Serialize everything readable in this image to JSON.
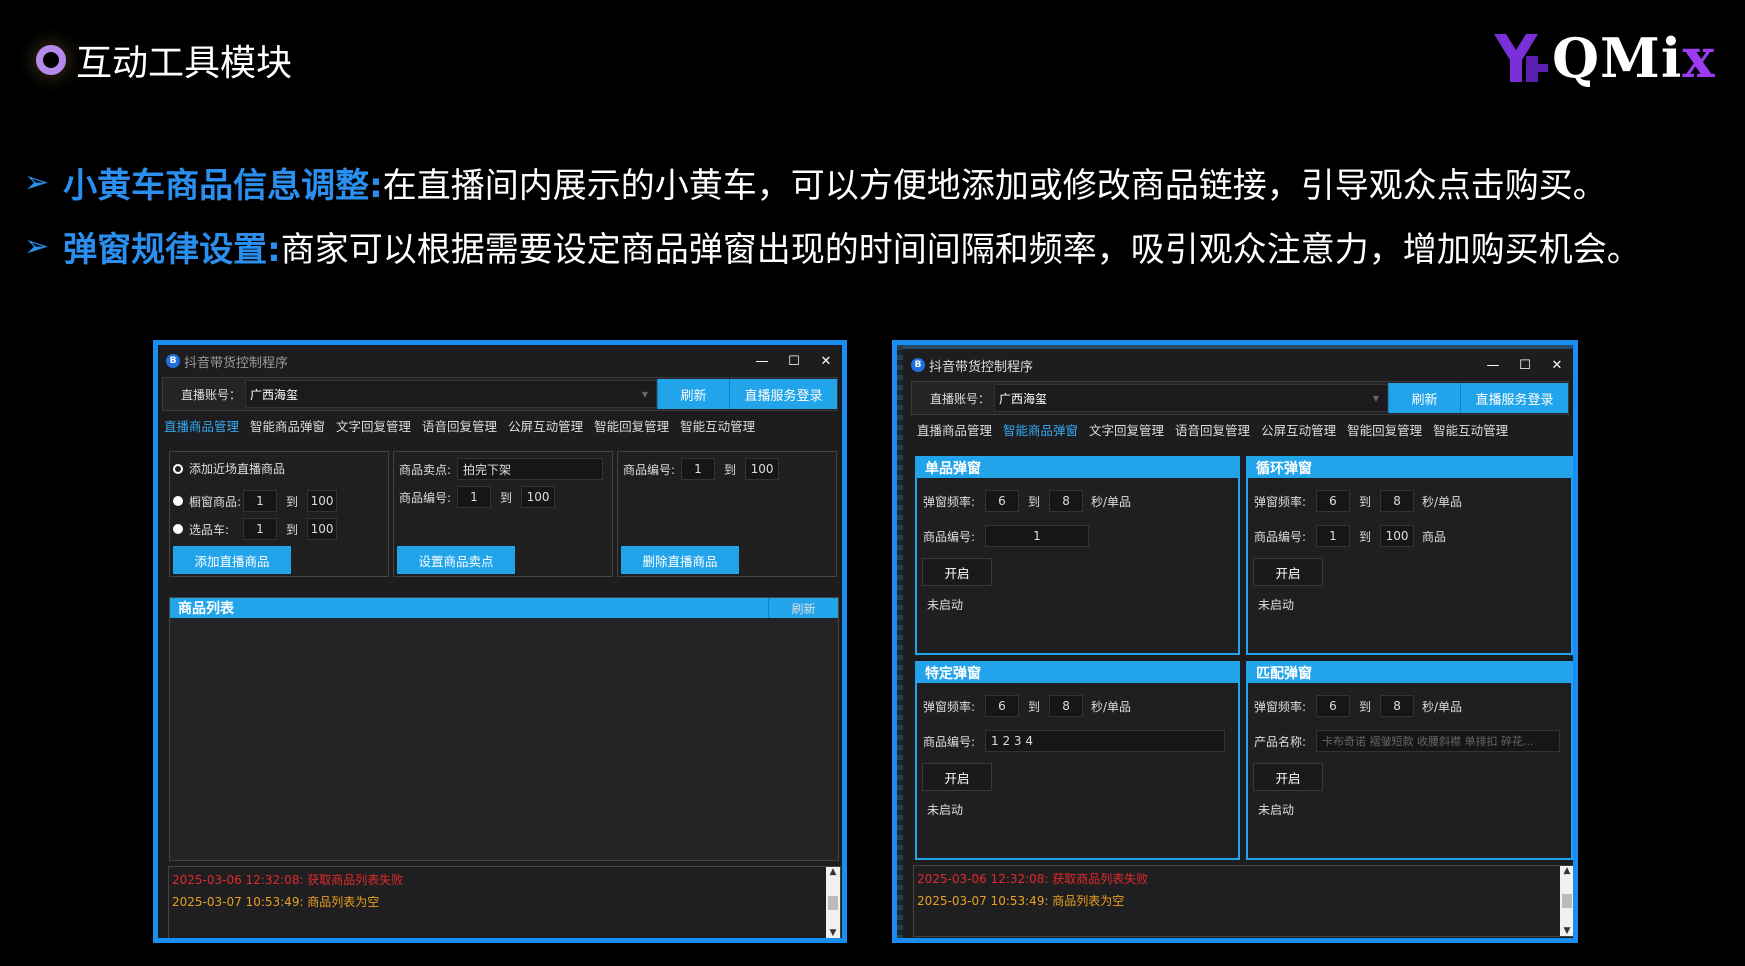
{
  "slide": {
    "title": "互动工具模块",
    "logo_text": "QMi",
    "logo_x": "x",
    "bullets": [
      {
        "key": "小黄车商品信息调整:",
        "desc": "在直播间内展示的小黄车，可以方便地添加或修改商品链接，引导观众点击购买。"
      },
      {
        "key": "弹窗规律设置:",
        "desc": "商家可以根据需要设定商品弹窗出现的时间间隔和频率，吸引观众注意力，增加购买机会。"
      }
    ],
    "colors": {
      "accent": "#2b8ff0",
      "window_border": "#1a8df0",
      "button": "#22a4ea",
      "error": "#e02a2a",
      "warn": "#e8a020"
    }
  },
  "common": {
    "app_title": "抖音带货控制程序",
    "app_icon": "B",
    "minimize": "—",
    "maximize": "☐",
    "close": "✕",
    "account_label": "直播账号：",
    "account_value": "广西海玺",
    "refresh": "刷新",
    "login": "直播服务登录",
    "tabs": [
      "直播商品管理",
      "智能商品弹窗",
      "文字回复管理",
      "语音回复管理",
      "公屏互动管理",
      "智能回复管理",
      "智能互动管理"
    ],
    "to": "到",
    "log": [
      "2025-03-06 12:32:08: 获取商品列表失败",
      "2025-03-07 10:53:49: 商品列表为空"
    ]
  },
  "left": {
    "add_recent": "添加近场直播商品",
    "window_goods": "橱窗商品:",
    "select_cart": "选品车:",
    "from1": "1",
    "to100": "100",
    "add_btn": "添加直播商品",
    "sell_point_label": "商品卖点:",
    "sell_point_value": "拍完下架",
    "goods_no_label": "商品编号:",
    "set_sell_btn": "设置商品卖点",
    "delete_btn": "删除直播商品",
    "list_header": "商品列表",
    "list_refresh": "刷新"
  },
  "right": {
    "single": {
      "title": "单品弹窗",
      "freq_label": "弹窗频率:",
      "f1": "6",
      "f2": "8",
      "unit": "秒/单品",
      "goods_label": "商品编号:",
      "goods": "1",
      "start": "开启",
      "status": "未启动"
    },
    "loop": {
      "title": "循环弹窗",
      "freq_label": "弹窗频率:",
      "f1": "6",
      "f2": "8",
      "unit": "秒/单品",
      "goods_label": "商品编号:",
      "g1": "1",
      "g2": "100",
      "goods_unit": "商品",
      "start": "开启",
      "status": "未启动"
    },
    "specific": {
      "title": "特定弹窗",
      "freq_label": "弹窗频率:",
      "f1": "6",
      "f2": "8",
      "unit": "秒/单品",
      "goods_label": "商品编号:",
      "goods": "1 2 3 4",
      "start": "开启",
      "status": "未启动"
    },
    "match": {
      "title": "匹配弹窗",
      "freq_label": "弹窗频率:",
      "f1": "6",
      "f2": "8",
      "unit": "秒/单品",
      "name_label": "产品名称:",
      "name_placeholder": "卡布奇诺 褶皱短款 收腰斜襟 单排扣 碎花...",
      "start": "开启",
      "status": "未启动"
    }
  }
}
